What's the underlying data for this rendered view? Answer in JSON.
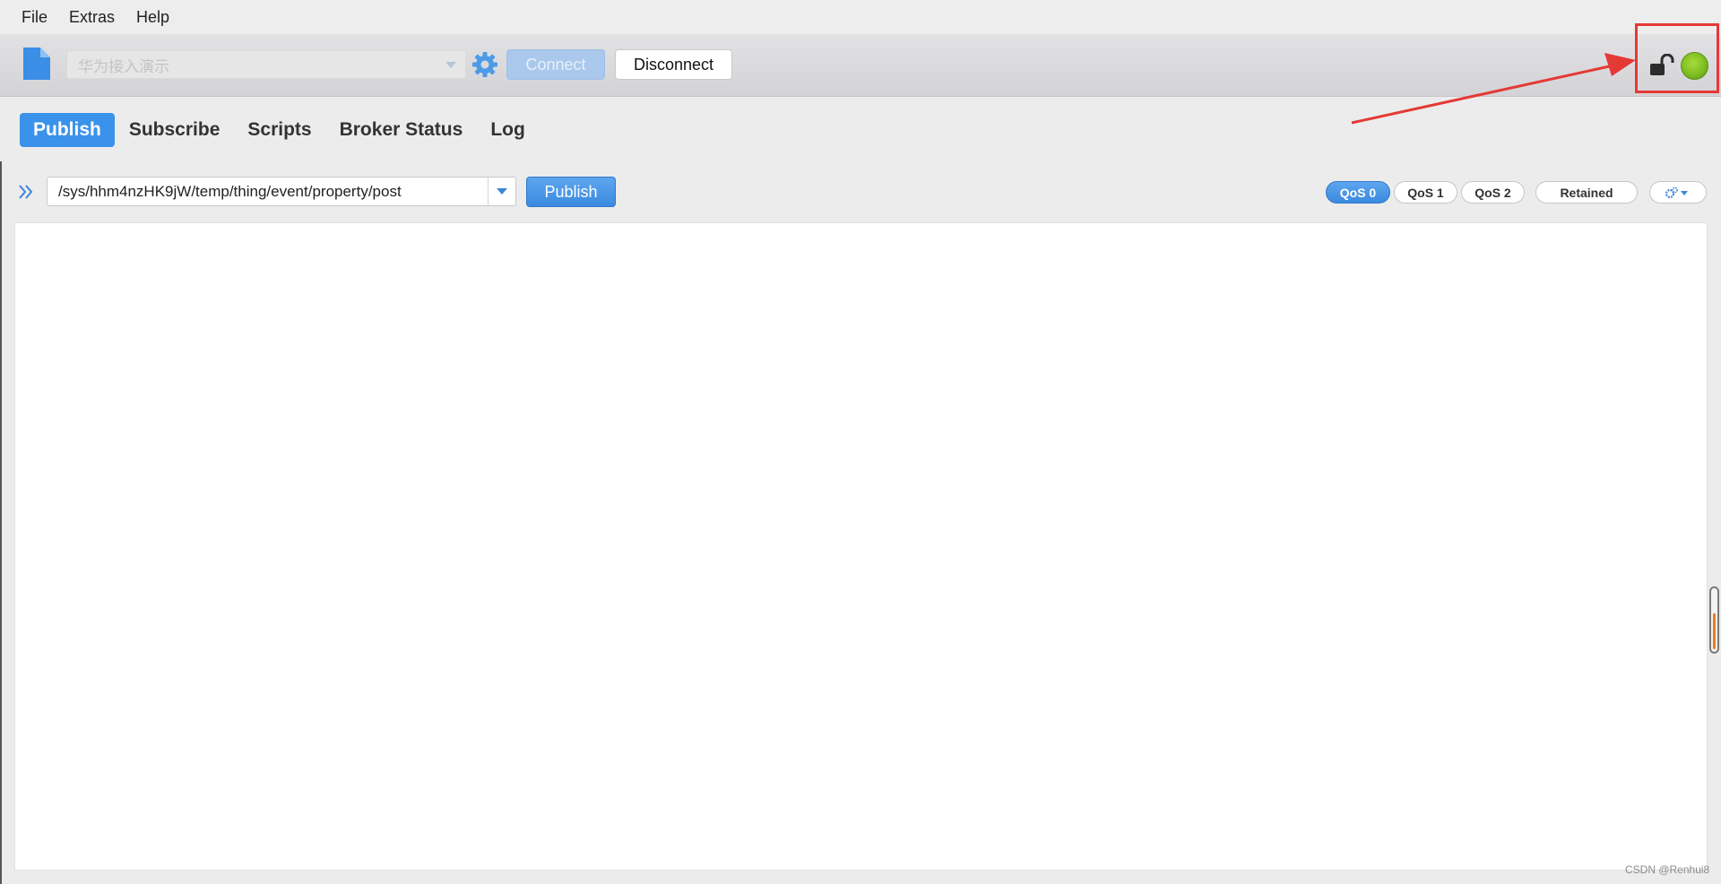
{
  "menu": [
    "File",
    "Extras",
    "Help"
  ],
  "toolbar": {
    "profile_value": "华为接入演示",
    "connect_label": "Connect",
    "disconnect_label": "Disconnect"
  },
  "tabs": [
    "Publish",
    "Subscribe",
    "Scripts",
    "Broker Status",
    "Log"
  ],
  "active_tab": "Publish",
  "publish": {
    "topic": "/sys/hhm4nzHK9jW/temp/thing/event/property/post",
    "publish_label": "Publish",
    "qos": [
      "QoS 0",
      "QoS 1",
      "QoS 2"
    ],
    "active_qos": "QoS 0",
    "retained_label": "Retained",
    "payload": ""
  },
  "status": {
    "connected_color": "#7fbe22",
    "accent": "#3a92ea",
    "annotation_color": "#e53935"
  },
  "icons": [
    "new-document-icon",
    "gear-icon",
    "unlock-icon",
    "connection-status-icon",
    "double-chevron-right-icon",
    "settings-dropdown-icon"
  ],
  "watermark": "CSDN @Renhui8"
}
